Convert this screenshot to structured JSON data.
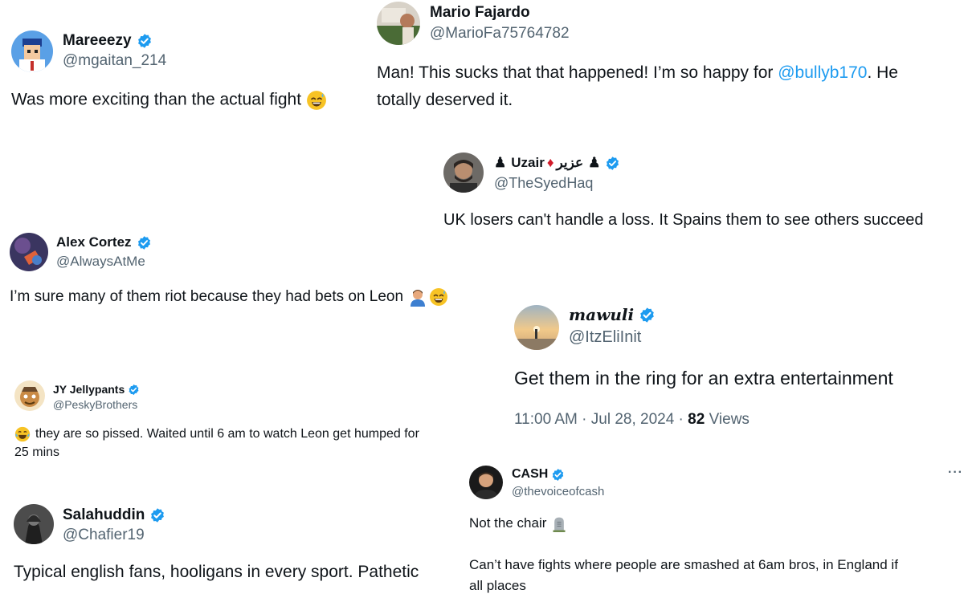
{
  "tweets": [
    {
      "name": "Mareeezy",
      "handle": "@mgaitan_214",
      "text": "Was more exciting than the actual fight",
      "emoji": "sweat-smile-emoji"
    },
    {
      "name": "Mario Fajardo",
      "handle": "@MarioFa75764782",
      "text_before": "Man! This sucks that that happened! I’m so happy for ",
      "mention": "@bullyb170",
      "text_after": ". He",
      "text_line2": "totally deserved it."
    },
    {
      "name": "Uzair",
      "name_suffix": "عزير",
      "handle": "@TheSyedHaq",
      "text": "UK losers can't handle a loss. It Spains them to see others succeed"
    },
    {
      "name": "Alex Cortez",
      "handle": "@AlwaysAtMe",
      "text": "I’m sure many of them riot because they had bets on Leon",
      "emoji": [
        "man-emoji",
        "sweat-smile-emoji"
      ]
    },
    {
      "name": "mawuli",
      "handle": "@ItzEliInit",
      "text": "Get them in the ring for an extra entertainment",
      "time": "11:00 AM · Jul 28, 2024 · ",
      "views_count": "82",
      "views_label": " Views"
    },
    {
      "name": "JY Jellypants",
      "handle": "@PeskyBrothers",
      "text_line1": "they are so pissed. Waited until 6 am to watch Leon get humped for",
      "text_line2": "25 mins",
      "emoji": "tears-of-joy-emoji"
    },
    {
      "name": "CASH",
      "handle": "@thevoiceofcash",
      "text_line1": "Not the chair",
      "text_line2": "Can’t have fights where people are smashed at 6am bros, in England if",
      "text_line3": "all places",
      "more": "···",
      "emoji": "headstone-emoji"
    },
    {
      "name": "Salahuddin",
      "handle": "@Chafier19",
      "text": "Typical english fans, hooligans in every sport. Pathetic"
    }
  ],
  "colors": {
    "verified": "#1d9bf0",
    "mention": "#1d9bf0",
    "handle": "#536471"
  }
}
